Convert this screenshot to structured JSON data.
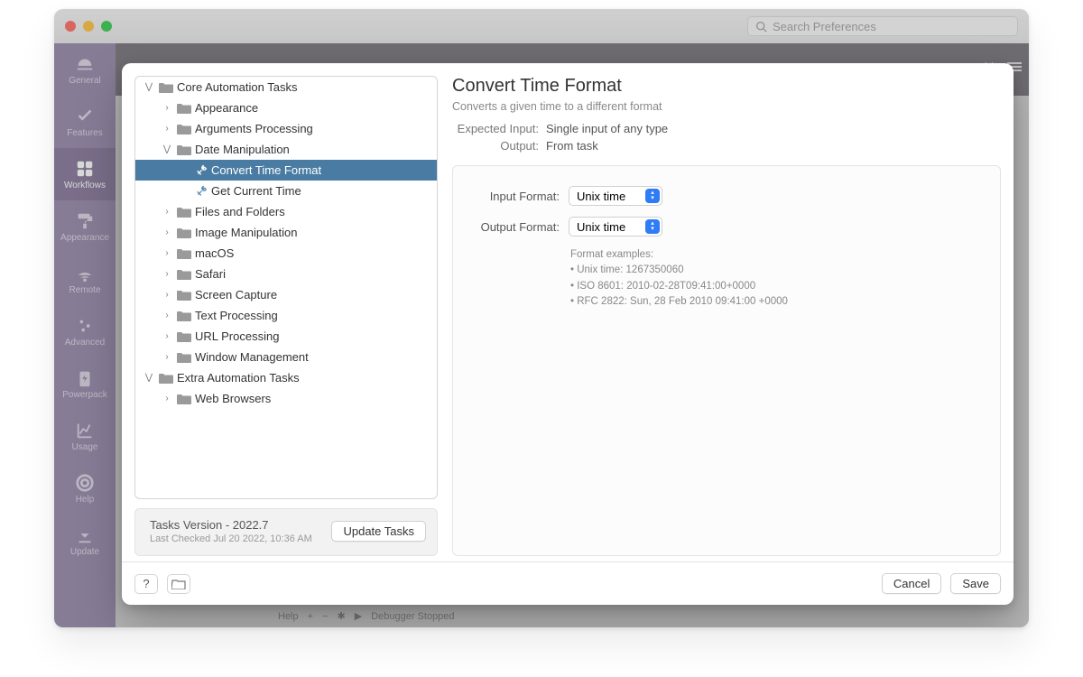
{
  "window": {
    "search_placeholder": "Search Preferences"
  },
  "nav": {
    "items": [
      {
        "label": "General",
        "icon": "hat"
      },
      {
        "label": "Features",
        "icon": "check"
      },
      {
        "label": "Workflows",
        "icon": "grid"
      },
      {
        "label": "Appearance",
        "icon": "roller"
      },
      {
        "label": "Remote",
        "icon": "remote"
      },
      {
        "label": "Advanced",
        "icon": "sliders"
      },
      {
        "label": "Powerpack",
        "icon": "battery"
      },
      {
        "label": "Usage",
        "icon": "chart"
      },
      {
        "label": "Help",
        "icon": "lifebuoy"
      },
      {
        "label": "Update",
        "icon": "download"
      }
    ],
    "active_index": 2
  },
  "backdrop": {
    "footer_help": "Help",
    "footer_debugger": "Debugger Stopped"
  },
  "tree": {
    "root": [
      {
        "label": "Core Automation Tasks",
        "type": "folder",
        "open": true,
        "children": [
          {
            "label": "Appearance",
            "type": "folder",
            "open": false
          },
          {
            "label": "Arguments Processing",
            "type": "folder",
            "open": false
          },
          {
            "label": "Date Manipulation",
            "type": "folder",
            "open": true,
            "children": [
              {
                "label": "Convert Time Format",
                "type": "tool",
                "selected": true
              },
              {
                "label": "Get Current Time",
                "type": "tool"
              }
            ]
          },
          {
            "label": "Files and Folders",
            "type": "folder",
            "open": false
          },
          {
            "label": "Image Manipulation",
            "type": "folder",
            "open": false
          },
          {
            "label": "macOS",
            "type": "folder",
            "open": false
          },
          {
            "label": "Safari",
            "type": "folder",
            "open": false
          },
          {
            "label": "Screen Capture",
            "type": "folder",
            "open": false
          },
          {
            "label": "Text Processing",
            "type": "folder",
            "open": false
          },
          {
            "label": "URL Processing",
            "type": "folder",
            "open": false
          },
          {
            "label": "Window Management",
            "type": "folder",
            "open": false
          }
        ]
      },
      {
        "label": "Extra Automation Tasks",
        "type": "folder",
        "open": true,
        "children": [
          {
            "label": "Web Browsers",
            "type": "folder",
            "open": false
          }
        ]
      }
    ]
  },
  "version": {
    "line1": "Tasks Version - 2022.7",
    "line2": "Last Checked Jul 20 2022, 10:36 AM",
    "update_btn": "Update Tasks"
  },
  "detail": {
    "title": "Convert Time Format",
    "subtitle": "Converts a given time to a different format",
    "expected_input_label": "Expected Input:",
    "expected_input_value": "Single input of any type",
    "output_label": "Output:",
    "output_value": "From task",
    "input_format_label": "Input Format:",
    "input_format_value": "Unix time",
    "output_format_label": "Output Format:",
    "output_format_value": "Unix time",
    "examples_header": "Format examples:",
    "example1": "• Unix time: 1267350060",
    "example2": "• ISO 8601: 2010-02-28T09:41:00+0000",
    "example3": "• RFC 2822: Sun, 28 Feb 2010 09:41:00 +0000"
  },
  "footer": {
    "help": "?",
    "cancel": "Cancel",
    "save": "Save"
  }
}
